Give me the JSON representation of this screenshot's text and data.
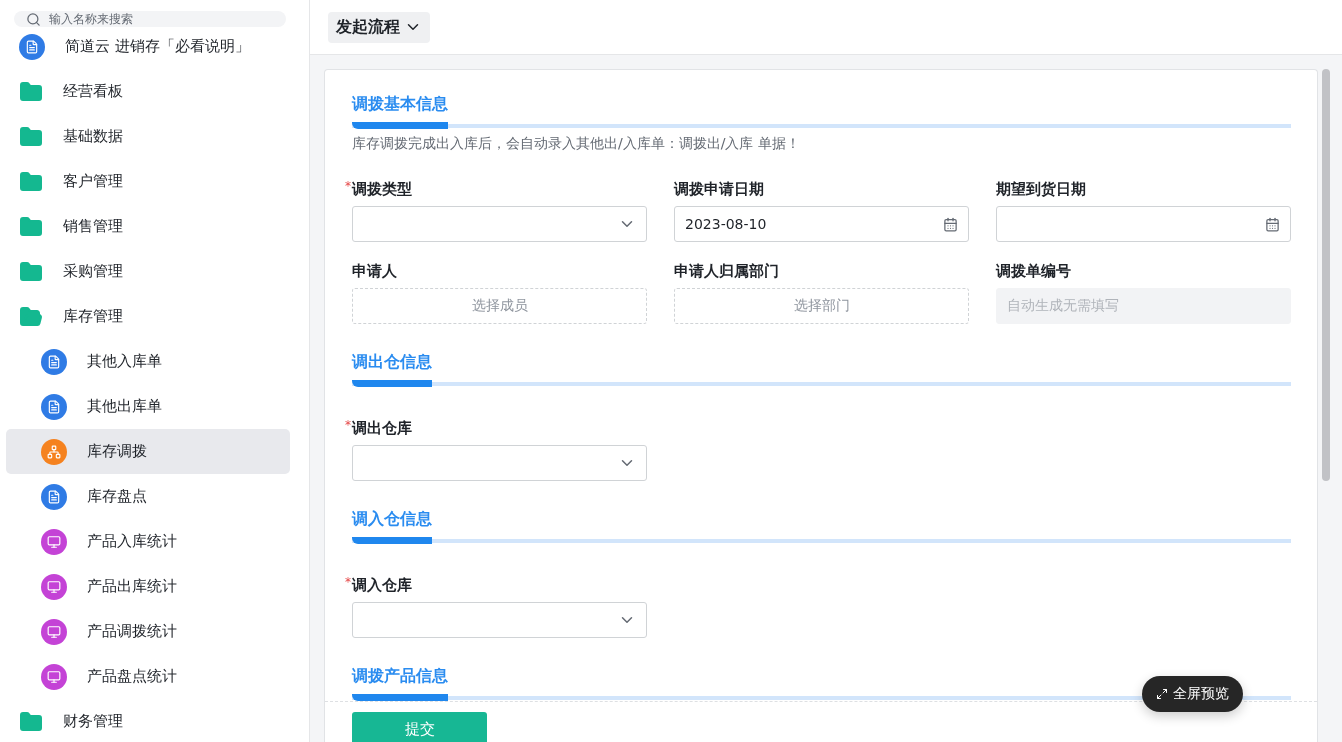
{
  "search": {
    "placeholder": "输入名称来搜索"
  },
  "sidebar": {
    "items": [
      {
        "kind": "doc",
        "label": "简道云 进销存「必看说明」",
        "selected": false
      },
      {
        "kind": "folder",
        "label": "经营看板",
        "selected": false,
        "expanded": false
      },
      {
        "kind": "folder",
        "label": "基础数据",
        "selected": false,
        "expanded": false
      },
      {
        "kind": "folder",
        "label": "客户管理",
        "selected": false,
        "expanded": false
      },
      {
        "kind": "folder",
        "label": "销售管理",
        "selected": false,
        "expanded": false
      },
      {
        "kind": "folder",
        "label": "采购管理",
        "selected": false,
        "expanded": false
      },
      {
        "kind": "folder",
        "label": "库存管理",
        "selected": false,
        "expanded": true,
        "children": [
          {
            "kind": "doc",
            "label": "其他入库单",
            "selected": false
          },
          {
            "kind": "doc",
            "label": "其他出库单",
            "selected": false
          },
          {
            "kind": "flow",
            "label": "库存调拨",
            "selected": true
          },
          {
            "kind": "doc",
            "label": "库存盘点",
            "selected": false
          },
          {
            "kind": "chart",
            "label": "产品入库统计",
            "selected": false
          },
          {
            "kind": "chart",
            "label": "产品出库统计",
            "selected": false
          },
          {
            "kind": "chart",
            "label": "产品调拨统计",
            "selected": false
          },
          {
            "kind": "chart",
            "label": "产品盘点统计",
            "selected": false
          }
        ]
      },
      {
        "kind": "folder",
        "label": "财务管理",
        "selected": false,
        "expanded": false
      }
    ]
  },
  "toolbar": {
    "menu": "发起流程"
  },
  "form": {
    "sections": [
      {
        "title": "调拨基本信息",
        "note": "库存调拨完成出入库后，会自动录入其他出/入库单：调拨出/入库 单据！",
        "fields": [
          {
            "kind": "select",
            "required_mark": "*",
            "label": "调拨类型"
          },
          {
            "kind": "date",
            "label": "调拨申请日期",
            "value": "2023-08-10"
          },
          {
            "kind": "date",
            "label": "期望到货日期"
          },
          {
            "kind": "picker",
            "label": "申请人",
            "placeholder": "选择成员"
          },
          {
            "kind": "picker",
            "label": "申请人归属部门",
            "placeholder": "选择部门"
          },
          {
            "kind": "readonly",
            "label": "调拨单编号",
            "placeholder": "自动生成无需填写"
          }
        ]
      },
      {
        "title": "调出仓信息",
        "fields": [
          {
            "kind": "select",
            "required_mark": "*",
            "label": "调出仓库"
          }
        ]
      },
      {
        "title": "调入仓信息",
        "fields": [
          {
            "kind": "select",
            "required_mark": "*",
            "label": "调入仓库"
          }
        ]
      },
      {
        "title": "调拨产品信息"
      }
    ],
    "submit": "提交"
  },
  "preview_button": "全屏预览"
}
